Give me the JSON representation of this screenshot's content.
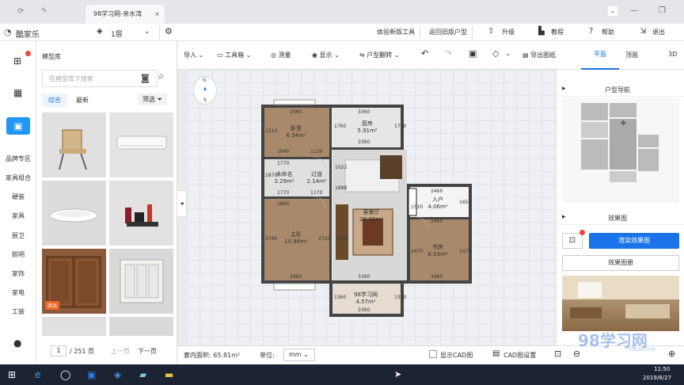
{
  "browser": {
    "tab_title": "98学习网-亲水湾"
  },
  "header": {
    "logo": "酷家乐",
    "floor": "1层",
    "buttons": [
      "体验新版工具",
      "返回旧版户型",
      "升级",
      "教程",
      "帮助",
      "退出"
    ]
  },
  "leftnav": {
    "categories": [
      "品牌专区",
      "家具组合",
      "硬装",
      "家具",
      "厨卫",
      "照明",
      "家饰",
      "家电",
      "工装"
    ]
  },
  "library": {
    "title": "模型库",
    "search_placeholder": "在模型库下搜索",
    "tabs": [
      "综合",
      "最新"
    ],
    "filter": "筛选",
    "badge": "商品",
    "page_current": "1",
    "page_total": "/ 251 页",
    "prev": "上一页",
    "next": "下一页"
  },
  "toolbar": {
    "tools": [
      "导入",
      "工具箱",
      "测量",
      "显示",
      "户型翻转",
      "导出图纸"
    ],
    "views": [
      "平面",
      "顶面",
      "3D"
    ]
  },
  "floorplan": {
    "compass": {
      "n": "N",
      "s": "S"
    },
    "rooms": [
      {
        "name": "卧室",
        "area": "6.54m²"
      },
      {
        "name": "厨房",
        "area": "5.91m²"
      },
      {
        "name": "未命名",
        "area": "3.29m²"
      },
      {
        "name": "过道",
        "area": "2.14m²"
      },
      {
        "name": "客餐厅",
        "area": "20.36m²"
      },
      {
        "name": "入户",
        "area": "4.06m²"
      },
      {
        "name": "主卧",
        "area": "10.98m²"
      },
      {
        "name": "书房",
        "area": "6.03m²"
      },
      {
        "name": "98学习网",
        "area": "4.57m²"
      }
    ],
    "dims": [
      "2960",
      "3360",
      "3360",
      "2210",
      "1760",
      "1760",
      "1840",
      "1120",
      "1770",
      "1870",
      "1770",
      "1170",
      "1888",
      "1022",
      "2460",
      "1650",
      "1520",
      "2460",
      "1840",
      "3740",
      "2720",
      "3720",
      "2470",
      "2470",
      "2960",
      "3360",
      "2460",
      "1360",
      "1360",
      "3360"
    ]
  },
  "rightpanel": {
    "nav_title": "户型导航",
    "effect_title": "效果图",
    "render_btn": "渲染效果图",
    "album_btn": "效果图册"
  },
  "status": {
    "area_label": "套内面积: 65.81m²",
    "unit_label": "单位:",
    "unit_value": "mm",
    "cad_show": "显示CAD图",
    "cad_settings": "CAD图设置"
  },
  "taskbar": {
    "time": "11:50",
    "date": "2019/8/27"
  },
  "watermark": {
    "text": "98学习网",
    "sub": "YXUEXI.COM"
  },
  "colors": {
    "accent": "#1a73e8",
    "nav_active": "#2196f3",
    "wood": "#a88a6a",
    "taskbar": "#1c2433"
  }
}
